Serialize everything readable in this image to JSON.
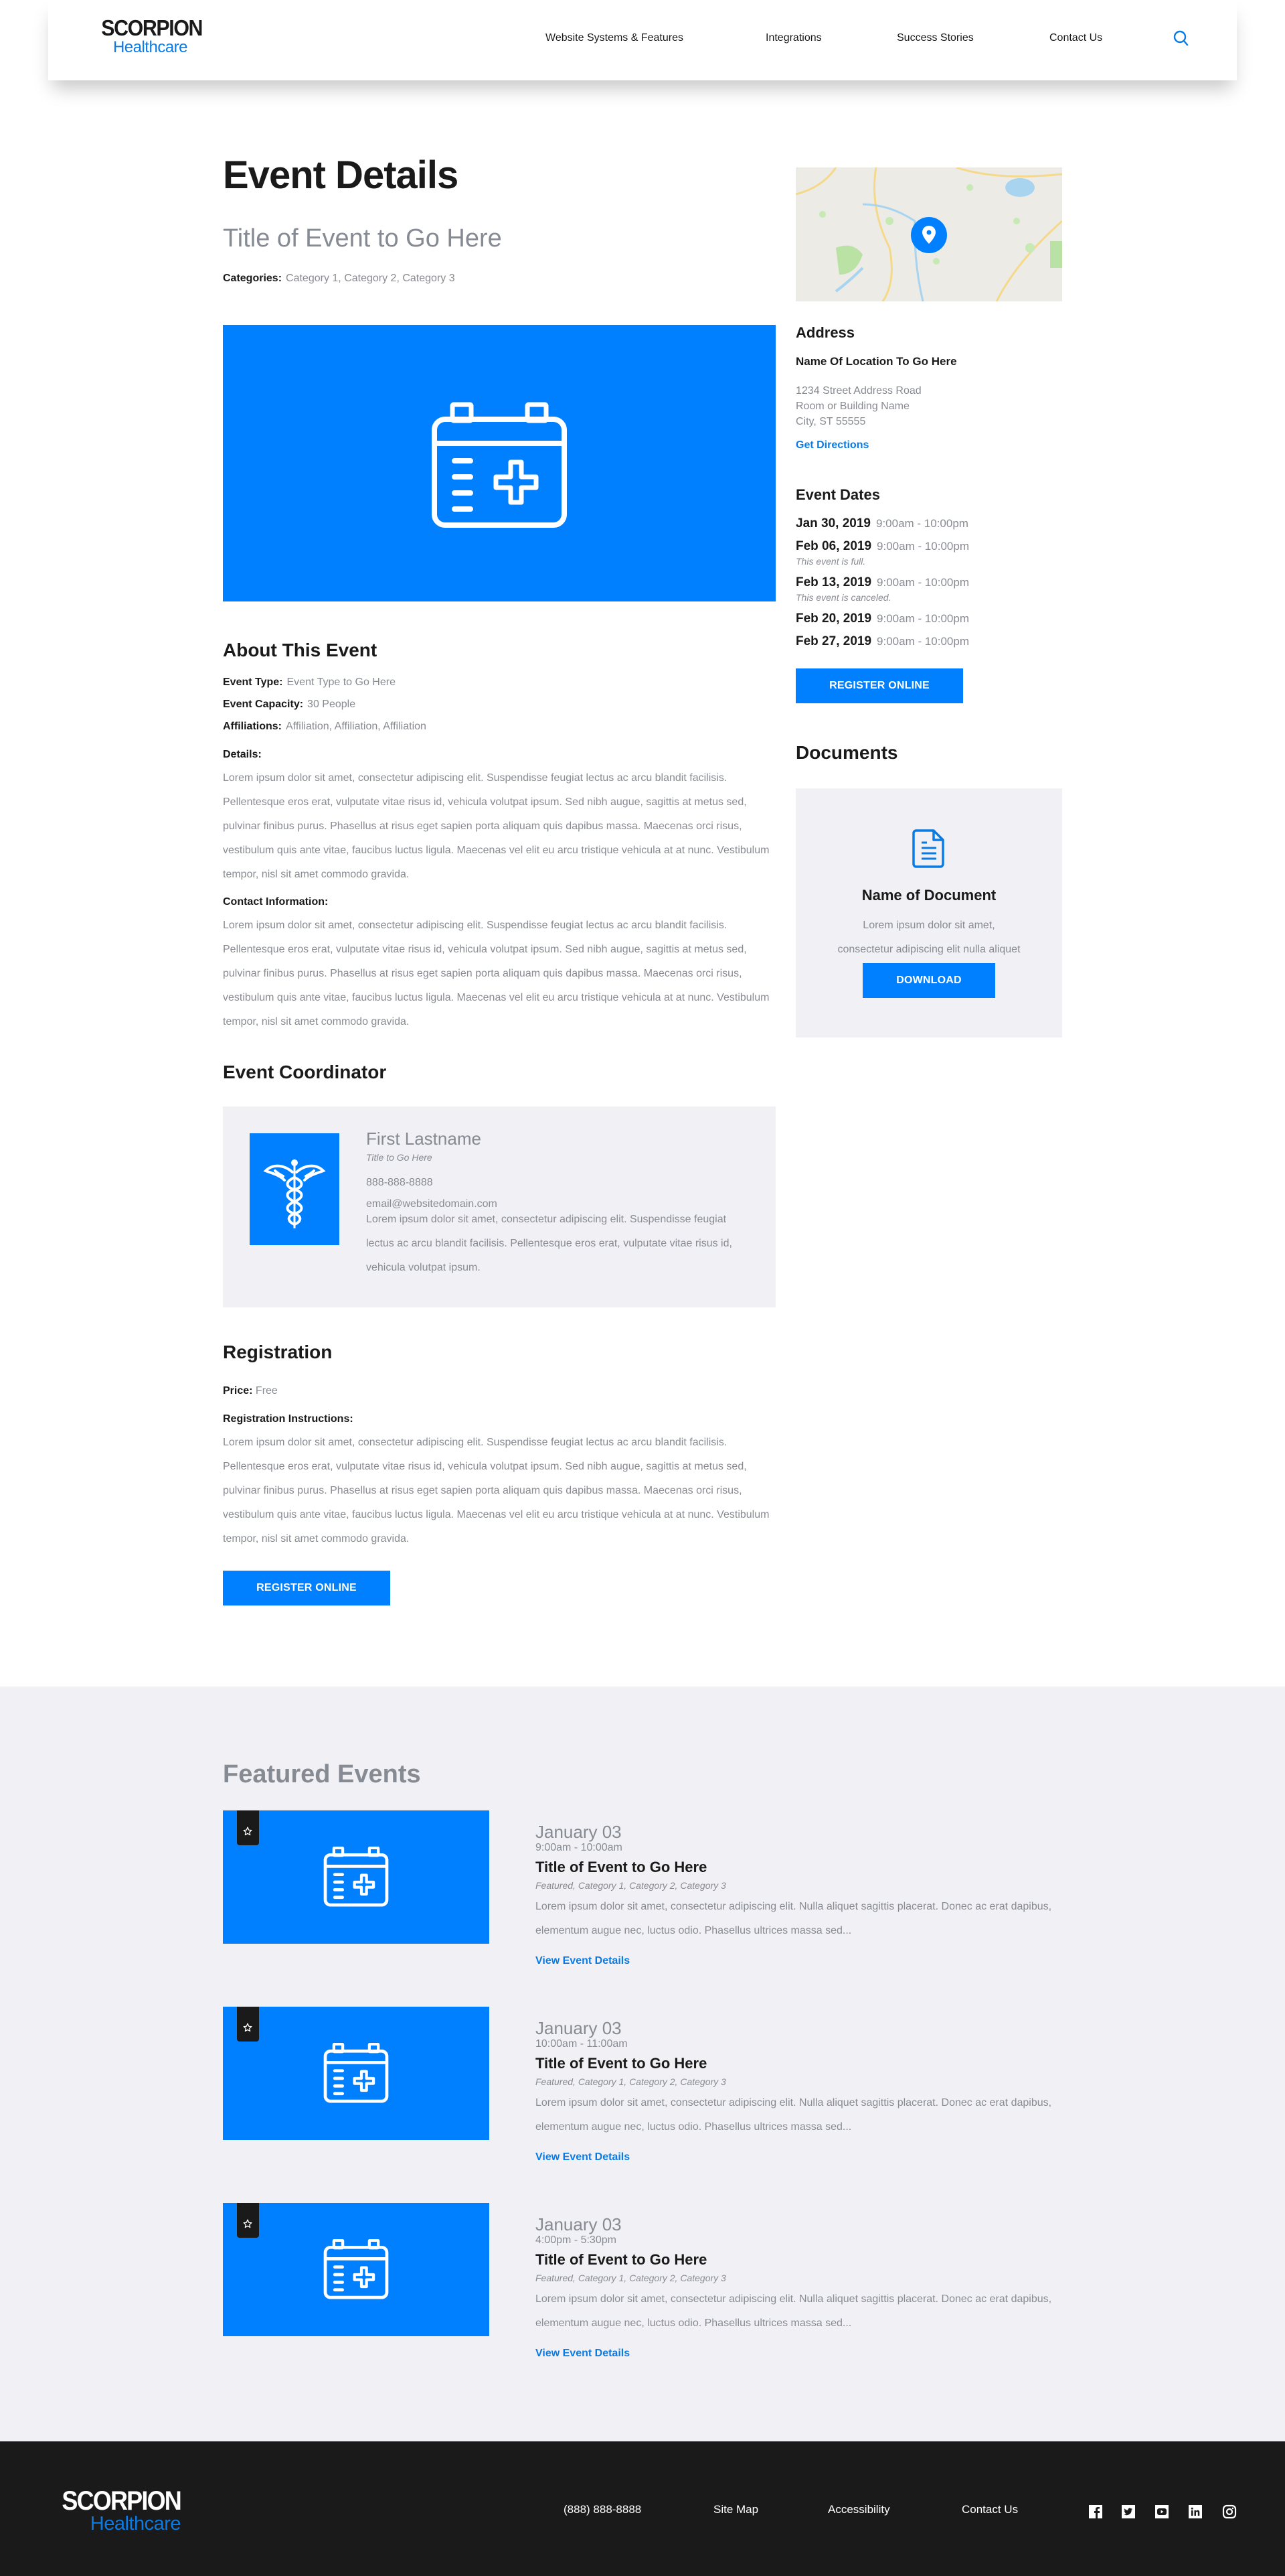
{
  "brand": {
    "name": "SCORPION",
    "sub": "Healthcare",
    "accent": "#0080FF"
  },
  "nav": {
    "items": [
      "Website Systems & Features",
      "Integrations",
      "Success Stories",
      "Contact Us"
    ],
    "search_icon": "search-icon"
  },
  "page": {
    "heading": "Event Details",
    "event_title": "Title of Event to Go Here",
    "categories_label": "Categories:",
    "categories_value": "Category 1, Category 2, Category 3"
  },
  "about": {
    "heading": "About This Event",
    "event_type_label": "Event Type:",
    "event_type_value": "Event Type to Go Here",
    "capacity_label": "Event Capacity:",
    "capacity_value": "30 People",
    "affiliations_label": "Affiliations:",
    "affiliations_value": "Affiliation, Affiliation, Affiliation",
    "details_label": "Details:",
    "details_text": "Lorem ipsum dolor sit amet, consectetur adipiscing elit. Suspendisse feugiat lectus ac arcu blandit facilisis. Pellentesque eros erat, vulputate vitae risus id, vehicula volutpat ipsum. Sed nibh augue, sagittis at metus sed, pulvinar finibus purus. Phasellus at risus eget sapien porta aliquam quis dapibus massa. Maecenas orci risus, vestibulum quis ante vitae, faucibus luctus ligula. Maecenas vel elit eu arcu tristique vehicula at at nunc. Vestibulum tempor, nisl sit amet commodo gravida.",
    "contact_label": "Contact Information:",
    "contact_text": "Lorem ipsum dolor sit amet, consectetur adipiscing elit. Suspendisse feugiat lectus ac arcu blandit facilisis. Pellentesque eros erat, vulputate vitae risus id, vehicula volutpat ipsum. Sed nibh augue, sagittis at metus sed, pulvinar finibus purus. Phasellus at risus eget sapien porta aliquam quis dapibus massa. Maecenas orci risus, vestibulum quis ante vitae, faucibus luctus ligula. Maecenas vel elit eu arcu tristique vehicula at at nunc. Vestibulum tempor, nisl sit amet commodo gravida."
  },
  "coordinator": {
    "heading": "Event Coordinator",
    "name": "First Lastname",
    "title": "Title to Go Here",
    "phone": "888-888-8888",
    "email": "email@websitedomain.com",
    "bio": "Lorem ipsum dolor sit amet, consectetur adipiscing elit. Suspendisse feugiat lectus ac arcu blandit facilisis. Pellentesque eros erat, vulputate vitae risus id, vehicula volutpat ipsum."
  },
  "registration": {
    "heading": "Registration",
    "price_label": "Price:",
    "price_value": "Free",
    "instructions_label": "Registration Instructions:",
    "instructions_text": "Lorem ipsum dolor sit amet, consectetur adipiscing elit. Suspendisse feugiat lectus ac arcu blandit facilisis. Pellentesque eros erat, vulputate vitae risus id, vehicula volutpat ipsum. Sed nibh augue, sagittis at metus sed, pulvinar finibus purus. Phasellus at risus eget sapien porta aliquam quis dapibus massa. Maecenas orci risus, vestibulum quis ante vitae, faucibus luctus ligula. Maecenas vel elit eu arcu tristique vehicula at at nunc. Vestibulum tempor, nisl sit amet commodo gravida.",
    "button": "REGISTER ONLINE"
  },
  "sidebar": {
    "address_heading": "Address",
    "location_name": "Name Of Location To Go Here",
    "address_lines": [
      "1234 Street Address Road",
      "Room or Building Name",
      "City, ST 55555"
    ],
    "directions": "Get Directions",
    "dates_heading": "Event Dates",
    "dates": [
      {
        "date": "Jan 30, 2019",
        "time": "9:00am - 10:00pm",
        "note": ""
      },
      {
        "date": "Feb 06, 2019",
        "time": "9:00am - 10:00pm",
        "note": "This event is full."
      },
      {
        "date": "Feb 13, 2019",
        "time": "9:00am - 10:00pm",
        "note": "This event is canceled."
      },
      {
        "date": "Feb 20, 2019",
        "time": "9:00am - 10:00pm",
        "note": ""
      },
      {
        "date": "Feb 27, 2019",
        "time": "9:00am - 10:00pm",
        "note": ""
      }
    ],
    "register_button": "REGISTER ONLINE",
    "documents_heading": "Documents",
    "document": {
      "name": "Name of Document",
      "desc_line1": "Lorem ipsum dolor sit amet,",
      "desc_line2": "consectetur adipiscing elit nulla aliquet",
      "button": "DOWNLOAD"
    }
  },
  "featured": {
    "heading": "Featured Events",
    "events": [
      {
        "date": "January 03",
        "time": "9:00am - 10:00am",
        "title": "Title of Event to Go Here",
        "categories": "Featured, Category 1, Category 2, Category 3",
        "desc": "Lorem ipsum dolor sit amet, consectetur adipiscing elit. Nulla aliquet sagittis placerat. Donec ac erat dapibus, elementum augue nec, luctus odio. Phasellus ultrices massa sed...",
        "link": "View Event Details"
      },
      {
        "date": "January 03",
        "time": "10:00am - 11:00am",
        "title": "Title of Event to Go Here",
        "categories": "Featured, Category 1, Category 2, Category 3",
        "desc": "Lorem ipsum dolor sit amet, consectetur adipiscing elit. Nulla aliquet sagittis placerat. Donec ac erat dapibus, elementum augue nec, luctus odio. Phasellus ultrices massa sed...",
        "link": "View Event Details"
      },
      {
        "date": "January 03",
        "time": "4:00pm - 5:30pm",
        "title": "Title of Event to Go Here",
        "categories": "Featured, Category 1, Category 2, Category 3",
        "desc": "Lorem ipsum dolor sit amet, consectetur adipiscing elit. Nulla aliquet sagittis placerat. Donec ac erat dapibus, elementum augue nec, luctus odio. Phasellus ultrices massa sed...",
        "link": "View Event Details"
      }
    ]
  },
  "footer": {
    "phone": "(888) 888-8888",
    "links": [
      "Site Map",
      "Accessibility",
      "Contact Us"
    ],
    "social": [
      "facebook-icon",
      "twitter-icon",
      "youtube-icon",
      "linkedin-icon",
      "instagram-icon"
    ]
  }
}
